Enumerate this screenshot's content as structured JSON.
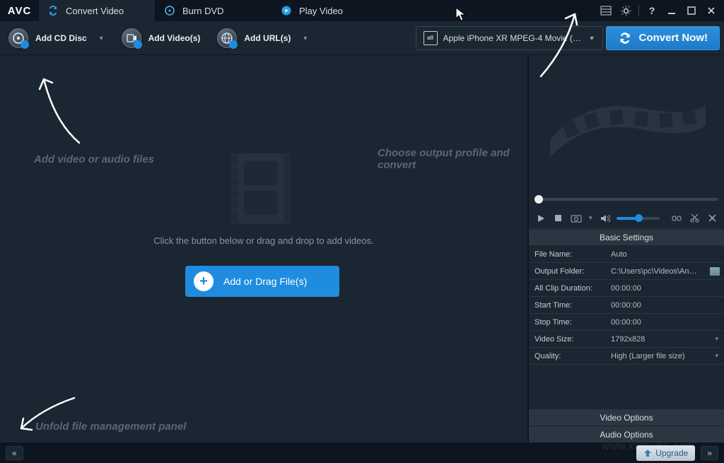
{
  "logo": "AVC",
  "tabs": [
    {
      "label": "Convert Video",
      "icon": "convert-icon"
    },
    {
      "label": "Burn DVD",
      "icon": "dvd-icon"
    },
    {
      "label": "Play Video",
      "icon": "play-icon"
    }
  ],
  "toolbar": {
    "add_cd": "Add CD Disc",
    "add_video": "Add Video(s)",
    "add_url": "Add URL(s)",
    "profile": "Apple iPhone XR MPEG-4 Movie (*.m…",
    "convert": "Convert Now!"
  },
  "hints": {
    "add_files": "Add video or audio files",
    "choose_profile": "Choose output profile and convert",
    "unfold": "Unfold file management panel"
  },
  "drop_text": "Click the button below or drag and drop to add videos.",
  "add_button": "Add or Drag File(s)",
  "basic_settings": {
    "header": "Basic Settings",
    "rows": [
      {
        "label": "File Name:",
        "value": "Auto",
        "type": "text"
      },
      {
        "label": "Output Folder:",
        "value": "C:\\Users\\pc\\Videos\\An…",
        "type": "browse"
      },
      {
        "label": "All Clip Duration:",
        "value": "00:00:00",
        "type": "text"
      },
      {
        "label": "Start Time:",
        "value": "00:00:00",
        "type": "text"
      },
      {
        "label": "Stop Time:",
        "value": "00:00:00",
        "type": "text"
      },
      {
        "label": "Video Size:",
        "value": "1792x828",
        "type": "dd"
      },
      {
        "label": "Quality:",
        "value": "High (Larger file size)",
        "type": "dd"
      }
    ]
  },
  "video_options": "Video Options",
  "audio_options": "Audio Options",
  "footer": {
    "collapse": "«",
    "upgrade": "Upgrade",
    "expand": "»"
  },
  "watermark": "www.xiazaiba.com"
}
